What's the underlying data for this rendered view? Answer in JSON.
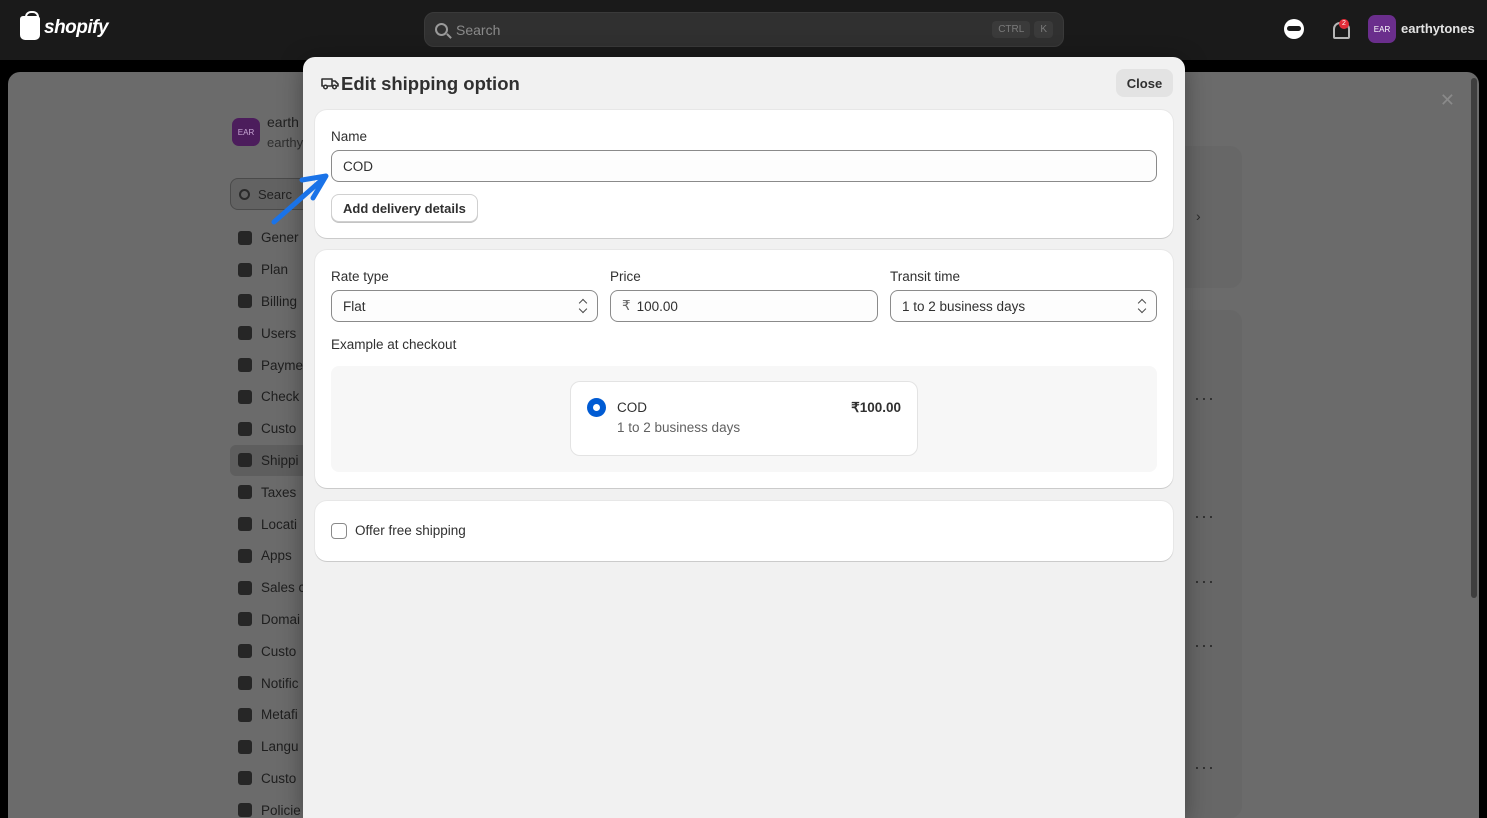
{
  "topbar": {
    "brand": "shopify",
    "search_placeholder": "Search",
    "shortcut_ctrl": "CTRL",
    "shortcut_key": "K",
    "notification_count": "2",
    "user_initials": "EAR",
    "user_name": "earthytones"
  },
  "background": {
    "store_initials": "EAR",
    "store_name": "earth",
    "store_sub": "earthy",
    "search_text": "Searc",
    "nav": [
      "Gener",
      "Plan",
      "Billing",
      "Users",
      "Payme",
      "Check",
      "Custo",
      "Shippi",
      "Taxes",
      "Locati",
      "Apps",
      "Sales c",
      "Domai",
      "Custo",
      "Notific",
      "Metafi",
      "Langu",
      "Custo",
      "Policie"
    ]
  },
  "modal": {
    "title": "Edit shipping option",
    "close_label": "Close",
    "name_label": "Name",
    "name_value": "COD",
    "add_delivery_label": "Add delivery details",
    "rate_type_label": "Rate type",
    "rate_type_value": "Flat",
    "price_label": "Price",
    "currency_symbol": "₹",
    "price_value": "100.00",
    "transit_label": "Transit time",
    "transit_value": "1 to 2 business days",
    "example_label": "Example at checkout",
    "preview": {
      "name": "COD",
      "price": "₹100.00",
      "transit": "1 to 2 business days"
    },
    "free_shipping_label": "Offer free shipping"
  },
  "colors": {
    "accent": "#005bd3",
    "annotation_arrow": "#1a73e8",
    "topbar": "#1a1a1a"
  }
}
